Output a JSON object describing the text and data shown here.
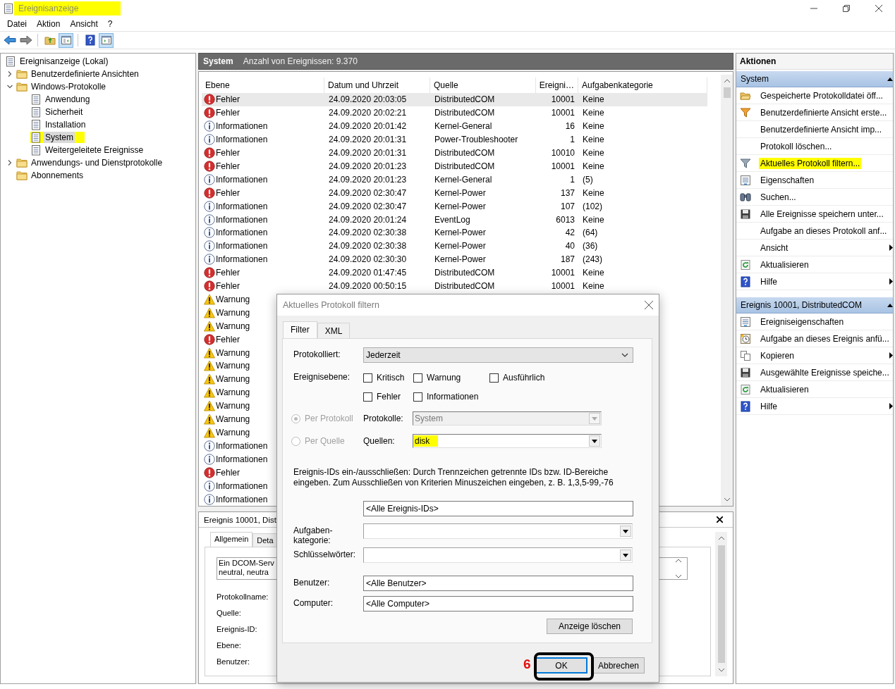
{
  "window": {
    "title": "Ereignisanzeige",
    "highlighted": true
  },
  "menu": [
    "Datei",
    "Aktion",
    "Ansicht",
    "?"
  ],
  "toolbar": [
    {
      "kind": "back",
      "pressed": false
    },
    {
      "kind": "forward",
      "pressed": false
    },
    {
      "kind": "separator"
    },
    {
      "kind": "up",
      "pressed": false
    },
    {
      "kind": "tree-pane",
      "pressed": true
    },
    {
      "kind": "separator"
    },
    {
      "kind": "help",
      "pressed": false
    },
    {
      "kind": "action-pane",
      "pressed": true
    }
  ],
  "tree": [
    {
      "label": "Ereignisanzeige (Lokal)",
      "kind": "log",
      "selected": false,
      "highlighted": false,
      "children": [
        {
          "label": "Benutzerdefinierte Ansichten",
          "kind": "folder",
          "expanded": false,
          "selected": false,
          "highlighted": false
        },
        {
          "label": "Windows-Protokolle",
          "kind": "folder",
          "expanded": true,
          "selected": false,
          "highlighted": false,
          "children": [
            {
              "label": "Anwendung",
              "kind": "log",
              "selected": false,
              "highlighted": false
            },
            {
              "label": "Sicherheit",
              "kind": "log",
              "selected": false,
              "highlighted": false
            },
            {
              "label": "Installation",
              "kind": "log",
              "selected": false,
              "highlighted": false
            },
            {
              "label": "System",
              "kind": "log",
              "selected": true,
              "highlighted": true
            },
            {
              "label": "Weitergeleitete Ereignisse",
              "kind": "log",
              "selected": false,
              "highlighted": false
            }
          ]
        },
        {
          "label": "Anwendungs- und Dienstprotokolle",
          "kind": "folder",
          "expanded": false,
          "selected": false,
          "highlighted": false
        },
        {
          "label": "Abonnements",
          "kind": "folder",
          "selected": false,
          "highlighted": false
        }
      ]
    }
  ],
  "log_header": {
    "title": "System",
    "count": "Anzahl von Ereignissen: 9.370"
  },
  "table": {
    "columns": [
      "Ebene",
      "Datum und Uhrzeit",
      "Quelle",
      "Ereigni…",
      "Aufgabenkategorie"
    ],
    "rows": [
      {
        "kind": "error",
        "label": "Fehler",
        "date": "24.09.2020 20:03:05",
        "source": "DistributedCOM",
        "event_id": "10001",
        "category": "Keine",
        "selected": true
      },
      {
        "kind": "error",
        "label": "Fehler",
        "date": "24.09.2020 20:02:21",
        "source": "DistributedCOM",
        "event_id": "10001",
        "category": "Keine",
        "selected": false
      },
      {
        "kind": "info",
        "label": "Informationen",
        "date": "24.09.2020 20:01:42",
        "source": "Kernel-General",
        "event_id": "16",
        "category": "Keine",
        "selected": false
      },
      {
        "kind": "info",
        "label": "Informationen",
        "date": "24.09.2020 20:01:31",
        "source": "Power-Troubleshooter",
        "event_id": "1",
        "category": "Keine",
        "selected": false
      },
      {
        "kind": "error",
        "label": "Fehler",
        "date": "24.09.2020 20:01:31",
        "source": "DistributedCOM",
        "event_id": "10010",
        "category": "Keine",
        "selected": false
      },
      {
        "kind": "error",
        "label": "Fehler",
        "date": "24.09.2020 20:01:23",
        "source": "DistributedCOM",
        "event_id": "10001",
        "category": "Keine",
        "selected": false
      },
      {
        "kind": "info",
        "label": "Informationen",
        "date": "24.09.2020 20:01:23",
        "source": "Kernel-General",
        "event_id": "1",
        "category": "(5)",
        "selected": false
      },
      {
        "kind": "error",
        "label": "Fehler",
        "date": "24.09.2020 02:30:47",
        "source": "Kernel-Power",
        "event_id": "137",
        "category": "Keine",
        "selected": false
      },
      {
        "kind": "info",
        "label": "Informationen",
        "date": "24.09.2020 02:30:47",
        "source": "Kernel-Power",
        "event_id": "107",
        "category": "(102)",
        "selected": false
      },
      {
        "kind": "info",
        "label": "Informationen",
        "date": "24.09.2020 20:01:24",
        "source": "EventLog",
        "event_id": "6013",
        "category": "Keine",
        "selected": false
      },
      {
        "kind": "info",
        "label": "Informationen",
        "date": "24.09.2020 02:30:38",
        "source": "Kernel-Power",
        "event_id": "42",
        "category": "(64)",
        "selected": false
      },
      {
        "kind": "info",
        "label": "Informationen",
        "date": "24.09.2020 02:30:38",
        "source": "Kernel-Power",
        "event_id": "40",
        "category": "(36)",
        "selected": false
      },
      {
        "kind": "info",
        "label": "Informationen",
        "date": "24.09.2020 02:30:30",
        "source": "Kernel-Power",
        "event_id": "187",
        "category": "(243)",
        "selected": false
      },
      {
        "kind": "error",
        "label": "Fehler",
        "date": "24.09.2020 01:47:45",
        "source": "DistributedCOM",
        "event_id": "10001",
        "category": "Keine",
        "selected": false
      },
      {
        "kind": "error",
        "label": "Fehler",
        "date": "24.09.2020 00:50:15",
        "source": "DistributedCOM",
        "event_id": "10001",
        "category": "Keine",
        "selected": false
      },
      {
        "kind": "warning",
        "label": "Warnung",
        "selected": false
      },
      {
        "kind": "warning",
        "label": "Warnung",
        "selected": false
      },
      {
        "kind": "warning",
        "label": "Warnung",
        "selected": false
      },
      {
        "kind": "error",
        "label": "Fehler",
        "selected": false
      },
      {
        "kind": "warning",
        "label": "Warnung",
        "selected": false
      },
      {
        "kind": "warning",
        "label": "Warnung",
        "selected": false
      },
      {
        "kind": "warning",
        "label": "Warnung",
        "selected": false
      },
      {
        "kind": "warning",
        "label": "Warnung",
        "selected": false
      },
      {
        "kind": "warning",
        "label": "Warnung",
        "selected": false
      },
      {
        "kind": "warning",
        "label": "Warnung",
        "selected": false
      },
      {
        "kind": "warning",
        "label": "Warnung",
        "selected": false
      },
      {
        "kind": "info",
        "label": "Informationen",
        "selected": false
      },
      {
        "kind": "info",
        "label": "Informationen",
        "selected": false
      },
      {
        "kind": "error",
        "label": "Fehler",
        "selected": false
      },
      {
        "kind": "info",
        "label": "Informationen",
        "selected": false
      },
      {
        "kind": "info",
        "label": "Informationen",
        "selected": false
      }
    ]
  },
  "details": {
    "title": "Ereignis 10001, Dist",
    "tabs": [
      {
        "label": "Allgemein",
        "selected": true
      },
      {
        "label": "Deta",
        "selected": false
      }
    ],
    "message_lines": [
      "Ein DCOM-Serv",
      "neutral, neutra"
    ],
    "fields": [
      "Protokollname:",
      "Quelle:",
      "Ereignis-ID:",
      "Ebene:",
      "Benutzer:"
    ]
  },
  "actions": {
    "title": "Aktionen",
    "sections": [
      {
        "title": "System",
        "items": [
          {
            "label": "Gespeicherte Protokolldatei öff...",
            "kind": "open-folder",
            "submenu": false,
            "highlighted": false
          },
          {
            "label": "Benutzerdefinierte Ansicht erste...",
            "kind": "filter",
            "submenu": false,
            "highlighted": false
          },
          {
            "label": "Benutzerdefinierte Ansicht imp...",
            "submenu": false,
            "highlighted": false
          },
          {
            "label": "Protokoll löschen...",
            "submenu": false,
            "highlighted": false
          },
          {
            "label": "Aktuelles Protokoll filtern...",
            "kind": "filter-plain",
            "submenu": false,
            "highlighted": true
          },
          {
            "label": "Eigenschaften",
            "kind": "properties",
            "submenu": false,
            "highlighted": false
          },
          {
            "label": "Suchen...",
            "kind": "binoculars",
            "submenu": false,
            "highlighted": false
          },
          {
            "label": "Alle Ereignisse speichern unter...",
            "kind": "disk",
            "submenu": false,
            "highlighted": false
          },
          {
            "label": "Aufgabe an dieses Protokoll anf...",
            "submenu": false,
            "highlighted": false
          },
          {
            "label": "Ansicht",
            "submenu": true,
            "highlighted": false
          },
          {
            "label": "Aktualisieren",
            "kind": "refresh",
            "submenu": false,
            "highlighted": false
          },
          {
            "label": "Hilfe",
            "kind": "help",
            "submenu": true,
            "highlighted": false
          }
        ]
      },
      {
        "title": "Ereignis 10001, DistributedCOM",
        "items": [
          {
            "label": "Ereigniseigenschaften",
            "kind": "properties",
            "submenu": false,
            "highlighted": false
          },
          {
            "label": "Aufgabe an dieses Ereignis anfü...",
            "kind": "clock",
            "submenu": false,
            "highlighted": false
          },
          {
            "label": "Kopieren",
            "kind": "copy",
            "submenu": true,
            "highlighted": false
          },
          {
            "label": "Ausgewählte Ereignisse speiche...",
            "kind": "disk",
            "submenu": false,
            "highlighted": false
          },
          {
            "label": "Aktualisieren",
            "kind": "refresh",
            "submenu": false,
            "highlighted": false
          },
          {
            "label": "Hilfe",
            "kind": "help",
            "submenu": true,
            "highlighted": false
          }
        ]
      }
    ]
  },
  "dialog": {
    "title": "Aktuelles Protokoll filtern",
    "tabs": [
      {
        "label": "Filter",
        "selected": true
      },
      {
        "label": "XML",
        "selected": false
      }
    ],
    "logged": {
      "label": "Protokolliert:",
      "value": "Jederzeit"
    },
    "levels": {
      "label": "Ereignisebene:",
      "options": [
        {
          "label": "Kritisch",
          "checked": false
        },
        {
          "label": "Warnung",
          "checked": false
        },
        {
          "label": "Ausführlich",
          "checked": false
        },
        {
          "label": "Fehler",
          "checked": false
        },
        {
          "label": "Informationen",
          "checked": false
        }
      ]
    },
    "scope": {
      "disabled": true,
      "options": [
        {
          "label": "Per Protokoll",
          "selected": true,
          "field_label": "Protokolle:",
          "value": "System",
          "disabled": true,
          "highlighted": false
        },
        {
          "label": "Per Quelle",
          "selected": false,
          "field_label": "Quellen:",
          "value": "disk",
          "disabled": false,
          "highlighted": true
        }
      ]
    },
    "ids_hint": "Ereignis-IDs ein-/ausschließen: Durch Trennzeichen getrennte IDs bzw. ID-Bereiche eingeben. Zum Ausschließen von Kriterien Minuszeichen eingeben, z. B. 1,3,5-99,-76",
    "ids": {
      "value": "<Alle Ereignis-IDs>"
    },
    "category": {
      "label": "Aufgaben-kategorie:"
    },
    "keywords": {
      "label": "Schlüsselwörter:"
    },
    "user": {
      "label": "Benutzer:",
      "value": "<Alle Benutzer>"
    },
    "computer": {
      "label": "Computer:",
      "value": "<Alle Computer>"
    },
    "clear_button": "Anzeige löschen",
    "buttons": [
      {
        "label": "OK",
        "default": true
      },
      {
        "label": "Abbrechen",
        "default": false
      }
    ],
    "annotation": {
      "label": "6"
    }
  }
}
